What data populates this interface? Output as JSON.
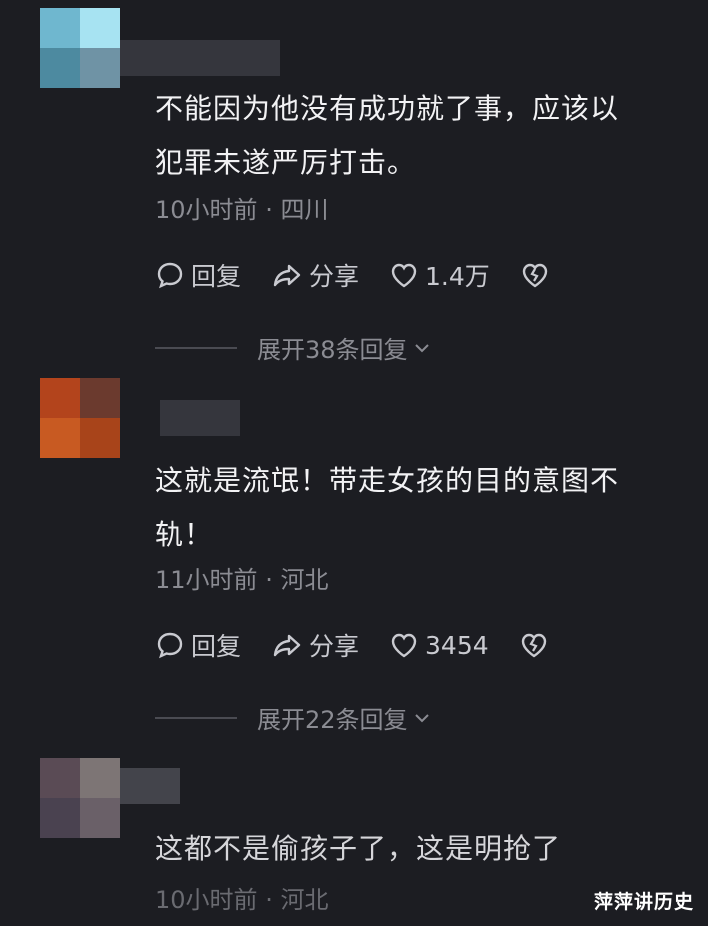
{
  "comments": [
    {
      "text_line1": "不能因为他没有成功就了事，应该以",
      "text_line2": "犯罪未遂严厉打击。",
      "time": "10小时前",
      "location": "四川",
      "reply_label": "回复",
      "share_label": "分享",
      "likes": "1.4万",
      "expand_label": "展开38条回复"
    },
    {
      "text_line1": "这就是流氓！带走女孩的目的意图不",
      "text_line2": "轨！",
      "time": "11小时前",
      "location": "河北",
      "reply_label": "回复",
      "share_label": "分享",
      "likes": "3454",
      "expand_label": "展开22条回复"
    },
    {
      "text_line1": "这都不是偷孩子了，这是明抢了",
      "time": "10小时前",
      "location": "河北"
    }
  ],
  "separator": "·",
  "watermark": "萍萍讲历史",
  "colors": {
    "background": "#1c1d22",
    "text": "#f2f2f4",
    "meta": "#8b8c93"
  }
}
